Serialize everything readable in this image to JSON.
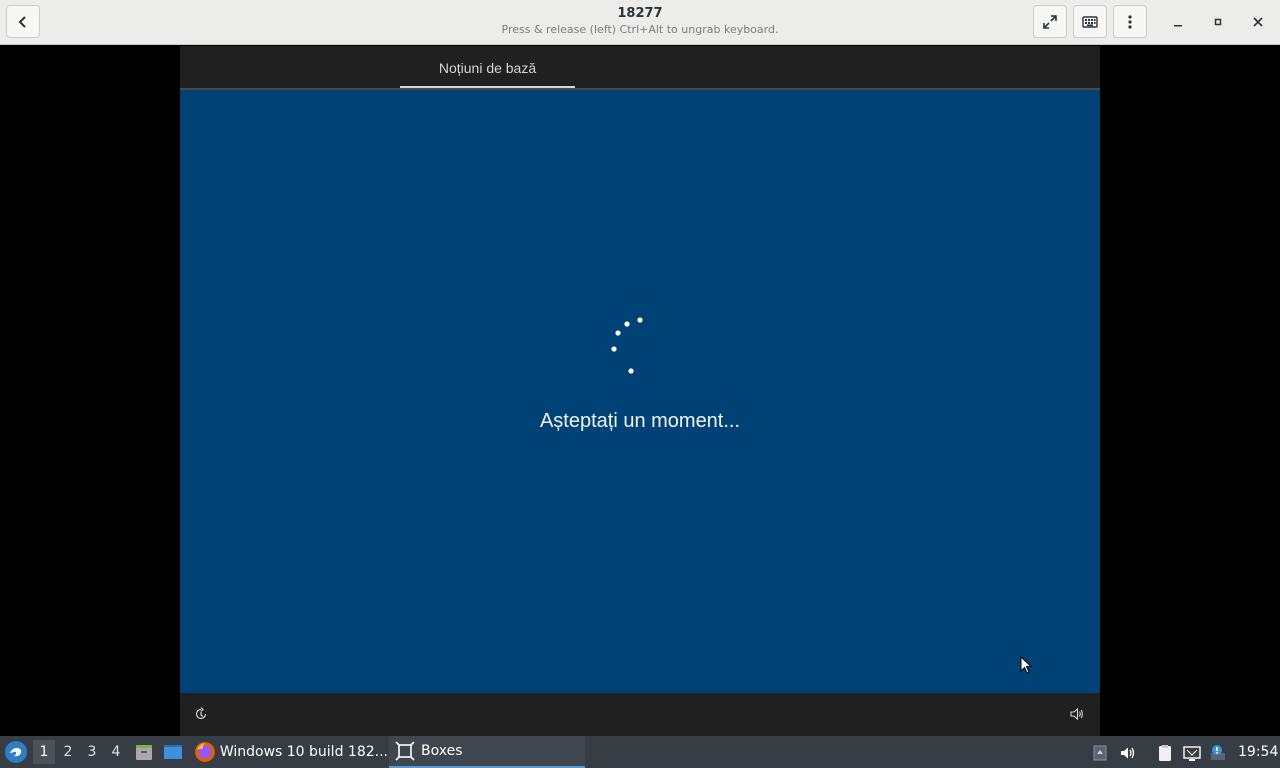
{
  "window": {
    "title": "18277",
    "subtitle": "Press & release (left) Ctrl+Alt to ungrab keyboard."
  },
  "vm": {
    "tab_label": "Noțiuni de bază",
    "message": "Așteptați un moment..."
  },
  "taskbar": {
    "workspaces": [
      "1",
      "2",
      "3",
      "4"
    ],
    "active_workspace": "1",
    "tasks": [
      {
        "label": "Windows 10 build 182...",
        "icon": "firefox-icon"
      },
      {
        "label": "Boxes",
        "icon": "boxes-icon"
      }
    ],
    "clock": "19:54"
  },
  "colors": {
    "vm_background": "#004275",
    "accent": "#5b9bd5"
  }
}
